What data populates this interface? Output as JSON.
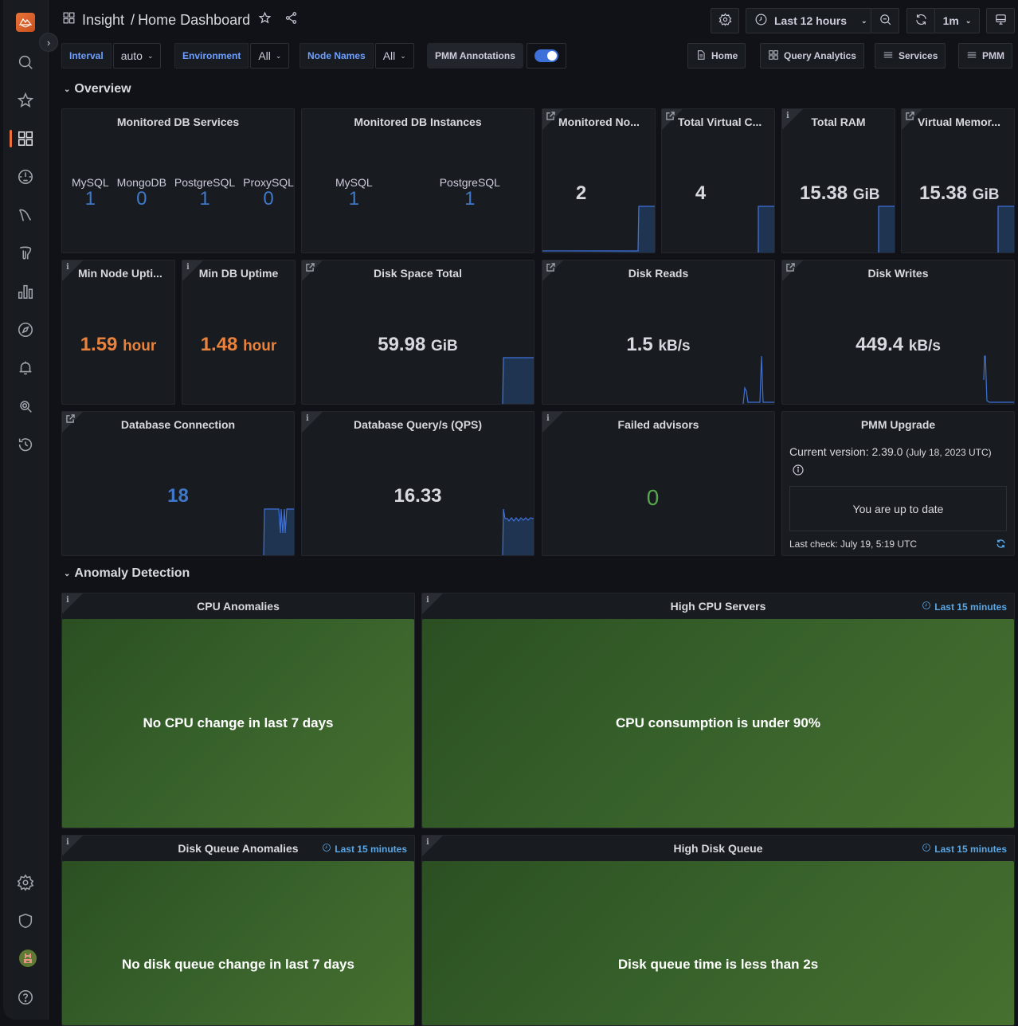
{
  "header": {
    "breadcrumb_folder": "Insight",
    "breadcrumb_separator": "/",
    "dashboard_title": "Home Dashboard",
    "time_range": "Last 12 hours",
    "refresh_interval": "1m"
  },
  "variables": [
    {
      "label": "Interval",
      "value": "auto"
    },
    {
      "label": "Environment",
      "value": "All"
    },
    {
      "label": "Node Names",
      "value": "All"
    }
  ],
  "annotations": {
    "label": "PMM Annotations",
    "enabled": true
  },
  "links": [
    "Home",
    "Query Analytics",
    "Services",
    "PMM"
  ],
  "rows": {
    "overview": "Overview",
    "anomaly": "Anomaly Detection"
  },
  "colors": {
    "accent_orange": "#f0703c",
    "value_blue": "#3f78c9",
    "value_orange": "#e8823c",
    "value_green": "#56a64b",
    "link_blue": "#6e9fff"
  },
  "panels": {
    "db_services": {
      "title": "Monitored DB Services",
      "items": [
        {
          "label": "MySQL",
          "value": "1"
        },
        {
          "label": "MongoDB",
          "value": "0"
        },
        {
          "label": "PostgreSQL",
          "value": "1"
        },
        {
          "label": "ProxySQL",
          "value": "0"
        }
      ]
    },
    "db_instances": {
      "title": "Monitored DB Instances",
      "items": [
        {
          "label": "MySQL",
          "value": "1"
        },
        {
          "label": "PostgreSQL",
          "value": "1"
        }
      ]
    },
    "monitored_nodes": {
      "title": "Monitored No...",
      "value": "2",
      "unit": ""
    },
    "total_vcpu": {
      "title": "Total Virtual C...",
      "value": "4",
      "unit": ""
    },
    "total_ram": {
      "title": "Total RAM",
      "value": "15.38",
      "unit": "GiB"
    },
    "virtual_memory": {
      "title": "Virtual Memor...",
      "value": "15.38",
      "unit": "GiB"
    },
    "min_node_uptime": {
      "title": "Min Node Upti...",
      "value": "1.59",
      "unit": "hour"
    },
    "min_db_uptime": {
      "title": "Min DB Uptime",
      "value": "1.48",
      "unit": "hour"
    },
    "disk_space": {
      "title": "Disk Space Total",
      "value": "59.98",
      "unit": "GiB"
    },
    "disk_reads": {
      "title": "Disk Reads",
      "value": "1.5",
      "unit": "kB/s"
    },
    "disk_writes": {
      "title": "Disk Writes",
      "value": "449.4",
      "unit": "kB/s"
    },
    "db_connection": {
      "title": "Database Connection",
      "value": "18"
    },
    "db_qps": {
      "title": "Database Query/s (QPS)",
      "value": "16.33"
    },
    "failed_advisors": {
      "title": "Failed advisors",
      "value": "0"
    },
    "pmm_upgrade": {
      "title": "PMM Upgrade",
      "current_version_label": "Current version: 2.39.0",
      "release_date": "(July 18, 2023 UTC)",
      "status": "You are up to date",
      "last_check": "Last check: July 19, 5:19 UTC"
    },
    "cpu_anomalies": {
      "title": "CPU Anomalies",
      "message": "No CPU change in last 7 days"
    },
    "high_cpu": {
      "title": "High CPU Servers",
      "time_override": "Last 15 minutes",
      "message": "CPU consumption is under 90%"
    },
    "disk_queue_anomalies": {
      "title": "Disk Queue Anomalies",
      "time_override": "Last 15 minutes",
      "message": "No disk queue change in last 7 days"
    },
    "high_disk_queue": {
      "title": "High Disk Queue",
      "time_override": "Last 15 minutes",
      "message": "Disk queue time is less than 2s"
    }
  }
}
